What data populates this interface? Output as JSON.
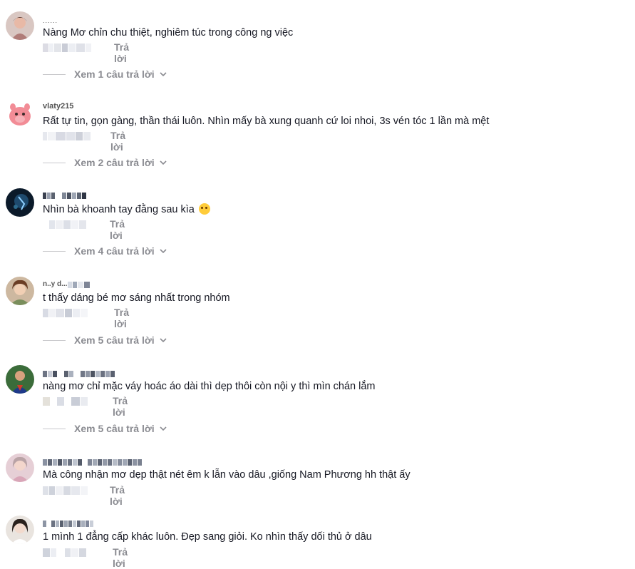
{
  "reply_label": "Trả lời",
  "comments": [
    {
      "username": "......",
      "text": "Nàng Mơ chỉn chu thiệt, nghiêm túc trong công ng việc",
      "view_replies": "Xem 1 câu trả lời"
    },
    {
      "username": "vlaty215",
      "text": "Rất tự tin, gọn gàng, thần thái luôn. Nhìn mấy bà xung quanh cứ loi nhoi, 3s vén tóc 1 lần mà mệt",
      "view_replies": "Xem 2 câu trả lời"
    },
    {
      "username": "",
      "text": "Nhìn bà khoanh tay đằng sau kìa",
      "view_replies": "Xem 4 câu trả lời"
    },
    {
      "username": "n..y d...",
      "text": "t thấy dáng bé mơ sáng nhất trong nhóm",
      "view_replies": "Xem 5 câu trả lời"
    },
    {
      "username": "",
      "text": "nàng mơ chỉ mặc váy hoác áo dài thì dẹp thôi còn nội y thì mìn chán lắm",
      "view_replies": "Xem 5 câu trả lời"
    },
    {
      "username": "",
      "text": "Mà công nhận mơ dẹp thật nét êm k lẫn vào dâu ,giống Nam Phương hh thật ấy",
      "view_replies": ""
    },
    {
      "username": "",
      "text": "1 mình 1 đẳng cấp khác luôn. Đẹp sang giỏi. Ko nhìn thấy dối thủ ở dâu",
      "view_replies": ""
    }
  ],
  "colors": {
    "text": "#161823",
    "muted": "#8a8b91",
    "divider": "#c9c9cc"
  }
}
